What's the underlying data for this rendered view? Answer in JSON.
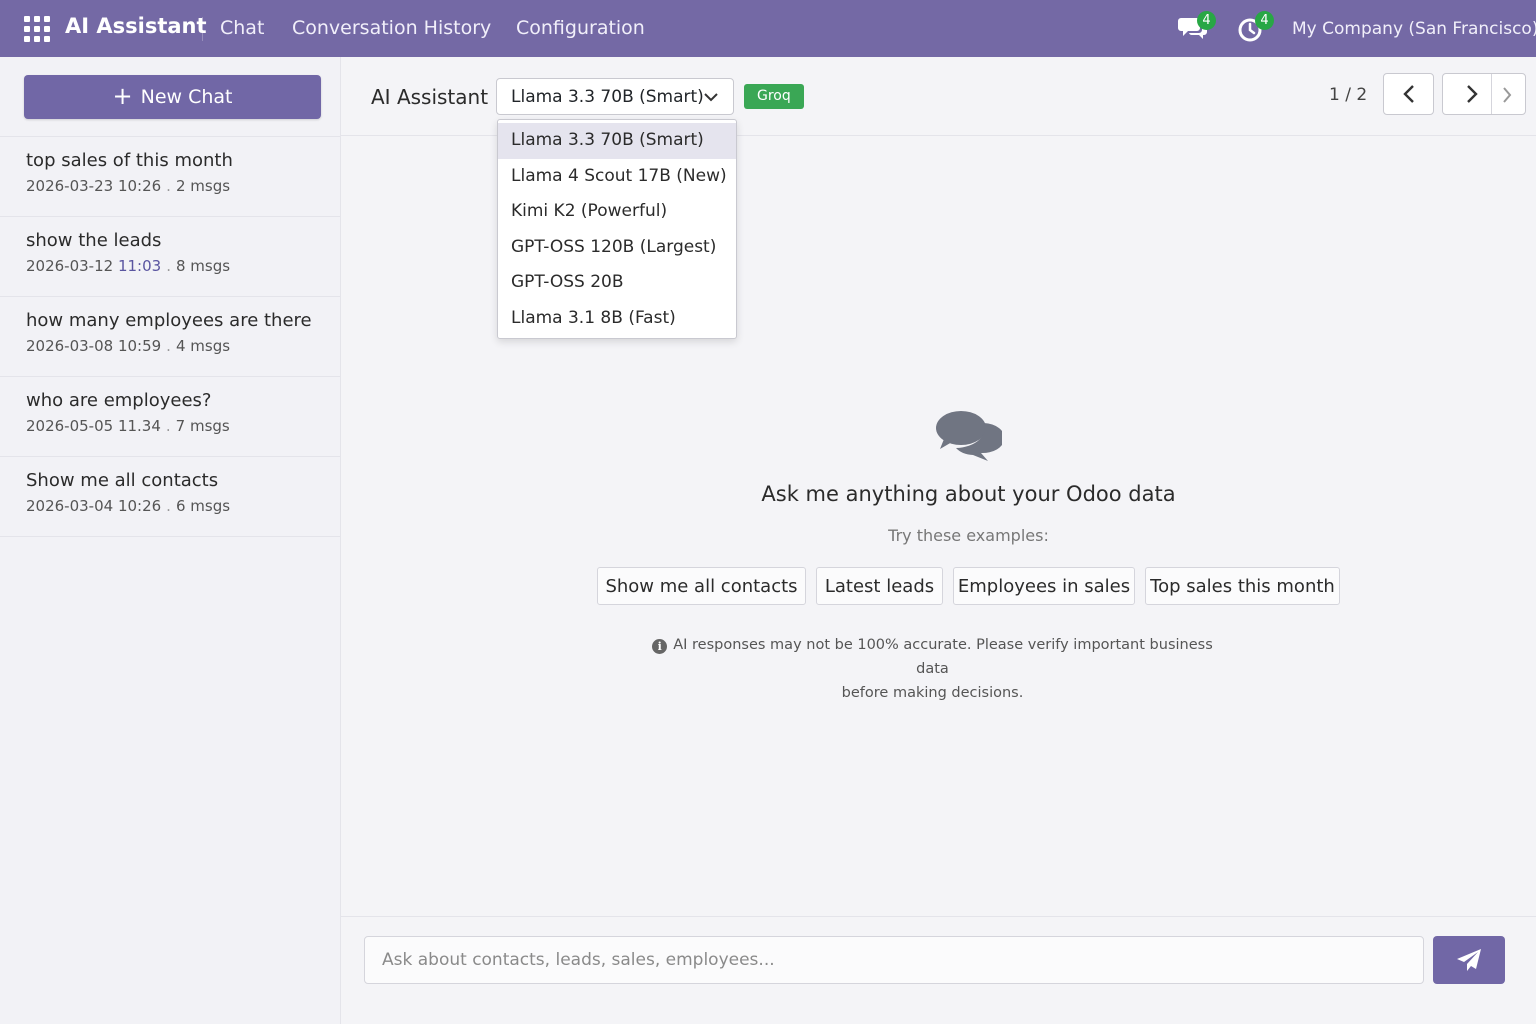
{
  "navbar": {
    "brand": "AI Assistant",
    "links": [
      "Chat",
      "Conversation History",
      "Configuration"
    ],
    "messages_badge": "4",
    "activities_badge": "4",
    "company": "My Company (San Francisco)"
  },
  "sidebar": {
    "new_chat_label": "New Chat",
    "conversations": [
      {
        "title": "top sales of this month",
        "date": "2026-03-23 10:26",
        "msgs": "2 msgs"
      },
      {
        "title": "show the leads",
        "date": "2026-03-12",
        "time": "11:03",
        "msgs": "8 msgs"
      },
      {
        "title": "how many employees are there",
        "date": "2026-03-08 10:59",
        "msgs": "4 msgs"
      },
      {
        "title": "who are employees?",
        "date": "2026-05-05 11.34",
        "msgs": "7 msgs"
      },
      {
        "title": "Show me all contacts",
        "date": "2026-03-04 10:26",
        "msgs": "6 msgs"
      }
    ],
    "separator": "."
  },
  "header": {
    "title": "AI Assistant",
    "selected_model": "Llama 3.3 70B (Smart)",
    "provider": "Groq",
    "pager": "1 / 2"
  },
  "model_options": [
    "Llama 3.3 70B (Smart)",
    "Llama 4 Scout 17B (New)",
    "Kimi K2 (Powerful)",
    "GPT-OSS 120B (Largest)",
    "GPT-OSS 20B",
    "Llama 3.1 8B (Fast)"
  ],
  "empty_state": {
    "title": "Ask me anything about your Odoo data",
    "subtitle": "Try these examples:",
    "examples": [
      "Show me all contacts",
      "Latest leads",
      "Employees in sales",
      "Top sales this month"
    ],
    "disclaimer_line1": "AI responses may not be 100% accurate. Please verify important business data",
    "disclaimer_line2": "before making decisions."
  },
  "composer": {
    "placeholder": "Ask about contacts, leads, sales, employees..."
  },
  "colors": {
    "navbar": "#7469a5",
    "primary_button": "#7167a6",
    "provider_badge": "#3aa755",
    "notification_badge": "#28a745"
  },
  "icons": [
    "apps-grid-icon",
    "chat-bubbles-icon",
    "clock-icon",
    "chevron-down-icon",
    "chevron-left-icon",
    "chevron-right-icon",
    "info-icon",
    "send-icon"
  ]
}
